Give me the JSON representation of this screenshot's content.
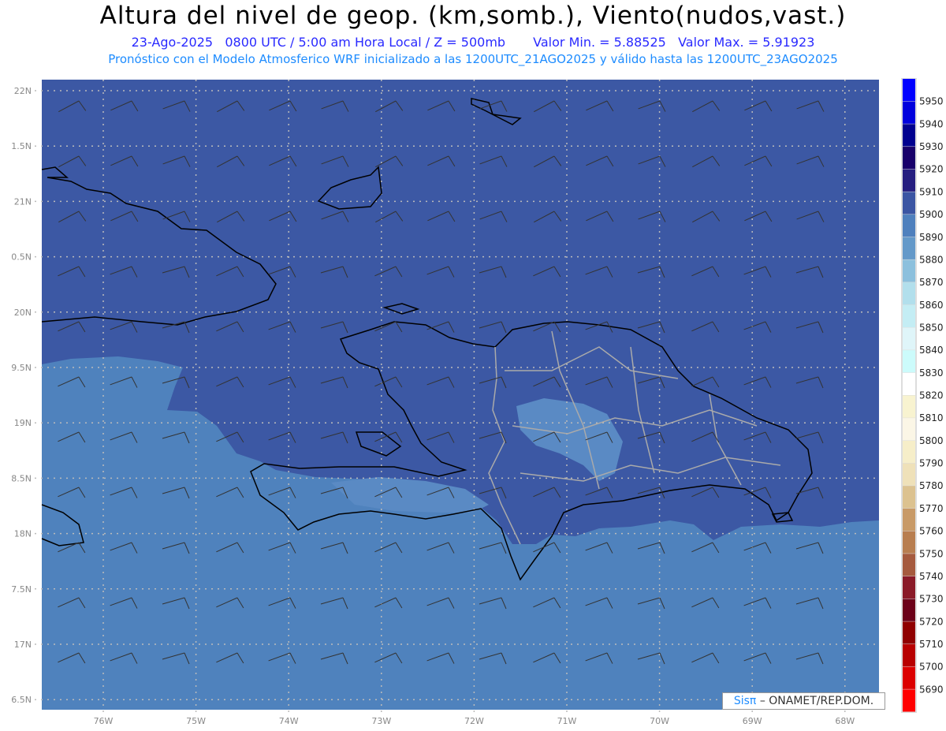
{
  "title": "Altura del nivel de geop. (km,somb.), Viento(nudos,vast.)",
  "subtitle": {
    "date": "23-Ago-2025",
    "time": "0800 UTC / 5:00 am Hora Local / Z = 500mb",
    "min": "Valor Min. = 5.88525",
    "max": "Valor Max. = 5.91923"
  },
  "description": "Pronóstico con el Modelo Atmosferico WRF inicializado a las 1200UTC_21AGO2025 y válido hasta las  1200UTC_23AGO2025",
  "axes": {
    "lat_labels": [
      "22N",
      "1.5N",
      "21N",
      "0.5N",
      "20N",
      "9.5N",
      "19N",
      "8.5N",
      "18N",
      "7.5N",
      "17N",
      "6.5N"
    ],
    "lon_labels": [
      "76W",
      "75W",
      "74W",
      "73W",
      "72W",
      "71W",
      "70W",
      "69W",
      "68W"
    ]
  },
  "colorbar": {
    "labels": [
      "5950",
      "5940",
      "5930",
      "5920",
      "5910",
      "5900",
      "5890",
      "5880",
      "5870",
      "5860",
      "5850",
      "5840",
      "5830",
      "5820",
      "5810",
      "5800",
      "5790",
      "5780",
      "5770",
      "5760",
      "5750",
      "5740",
      "5730",
      "5720",
      "5710",
      "5700",
      "5690"
    ],
    "colors": [
      "#0000ff",
      "#0000dd",
      "#00008f",
      "#18006a",
      "#261e80",
      "#3b55a3",
      "#4f80bd",
      "#6499c9",
      "#8cc0dd",
      "#b2dfec",
      "#c4edf4",
      "#dff5f9",
      "#ccfbfb",
      "#ffffff",
      "#f8f3d0",
      "#fbf6e6",
      "#f6eec9",
      "#efe1b9",
      "#dcc290",
      "#c89a67",
      "#b87e50",
      "#a55a3e",
      "#8a1a28",
      "#6c0018",
      "#900000",
      "#b80000",
      "#dc0000",
      "#ff0000"
    ]
  },
  "map_colors": {
    "dark": "#3c58a4",
    "light": "#4f82bd",
    "light_patch": "#5a8ac4"
  },
  "credit": {
    "logo": "Sisπ",
    "text": "– ONAMET/REP.DOM."
  }
}
